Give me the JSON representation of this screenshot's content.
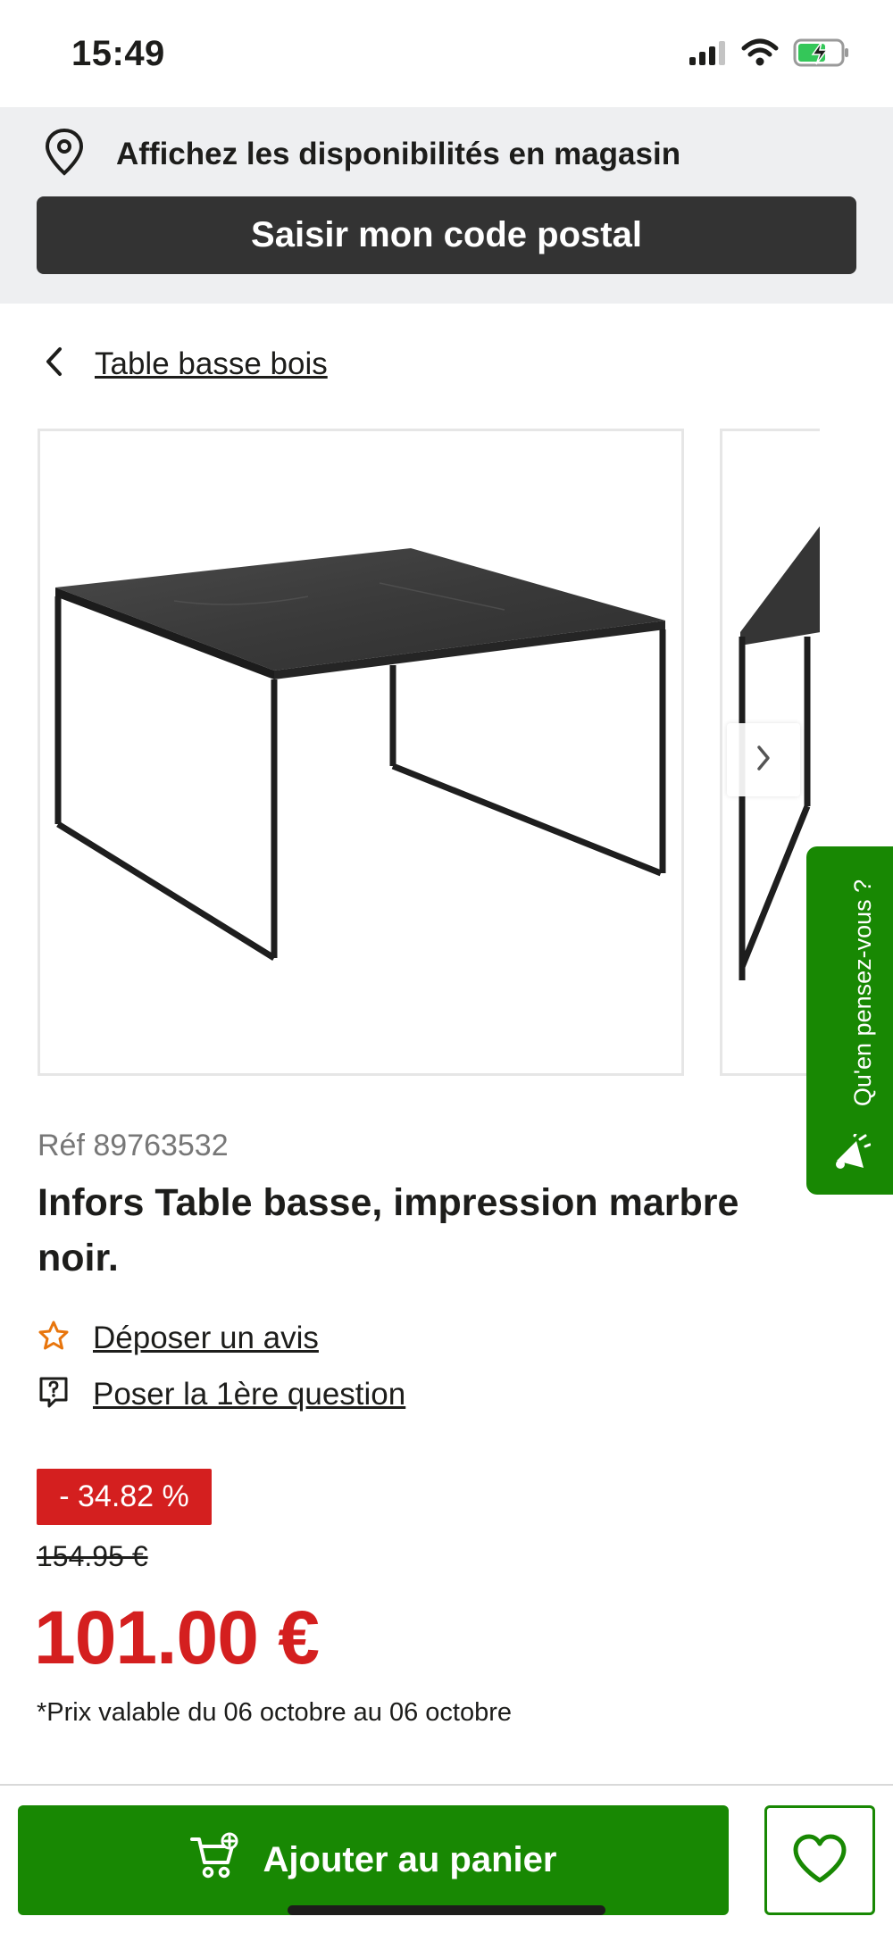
{
  "status_bar": {
    "time": "15:49",
    "icons": [
      "signal-icon",
      "wifi-icon",
      "battery-charging-icon"
    ]
  },
  "store_banner": {
    "text": "Affichez les disponibilités en magasin",
    "button_label": "Saisir mon code postal"
  },
  "breadcrumb": {
    "label": "Table basse bois"
  },
  "gallery": {
    "images": [
      "product-image-table-main",
      "product-image-table-alt"
    ]
  },
  "feedback_tab": {
    "label": "Qu'en pensez-vous ?"
  },
  "product": {
    "ref": "Réf 89763532",
    "title": "Infors Table basse, impression marbre noir.",
    "review_link": "Déposer un avis",
    "question_link": "Poser la 1ère question",
    "discount": "- 34.82 %",
    "old_price": "154.95 €",
    "price": "101.00 €",
    "price_note": "*Prix valable du 06 octobre au 06 octobre"
  },
  "actions": {
    "add_to_cart": "Ajouter au panier"
  },
  "colors": {
    "brand_green": "#188803",
    "price_red": "#d41f1f",
    "banner_bg": "#eeeff1",
    "dark_button": "#333333"
  }
}
